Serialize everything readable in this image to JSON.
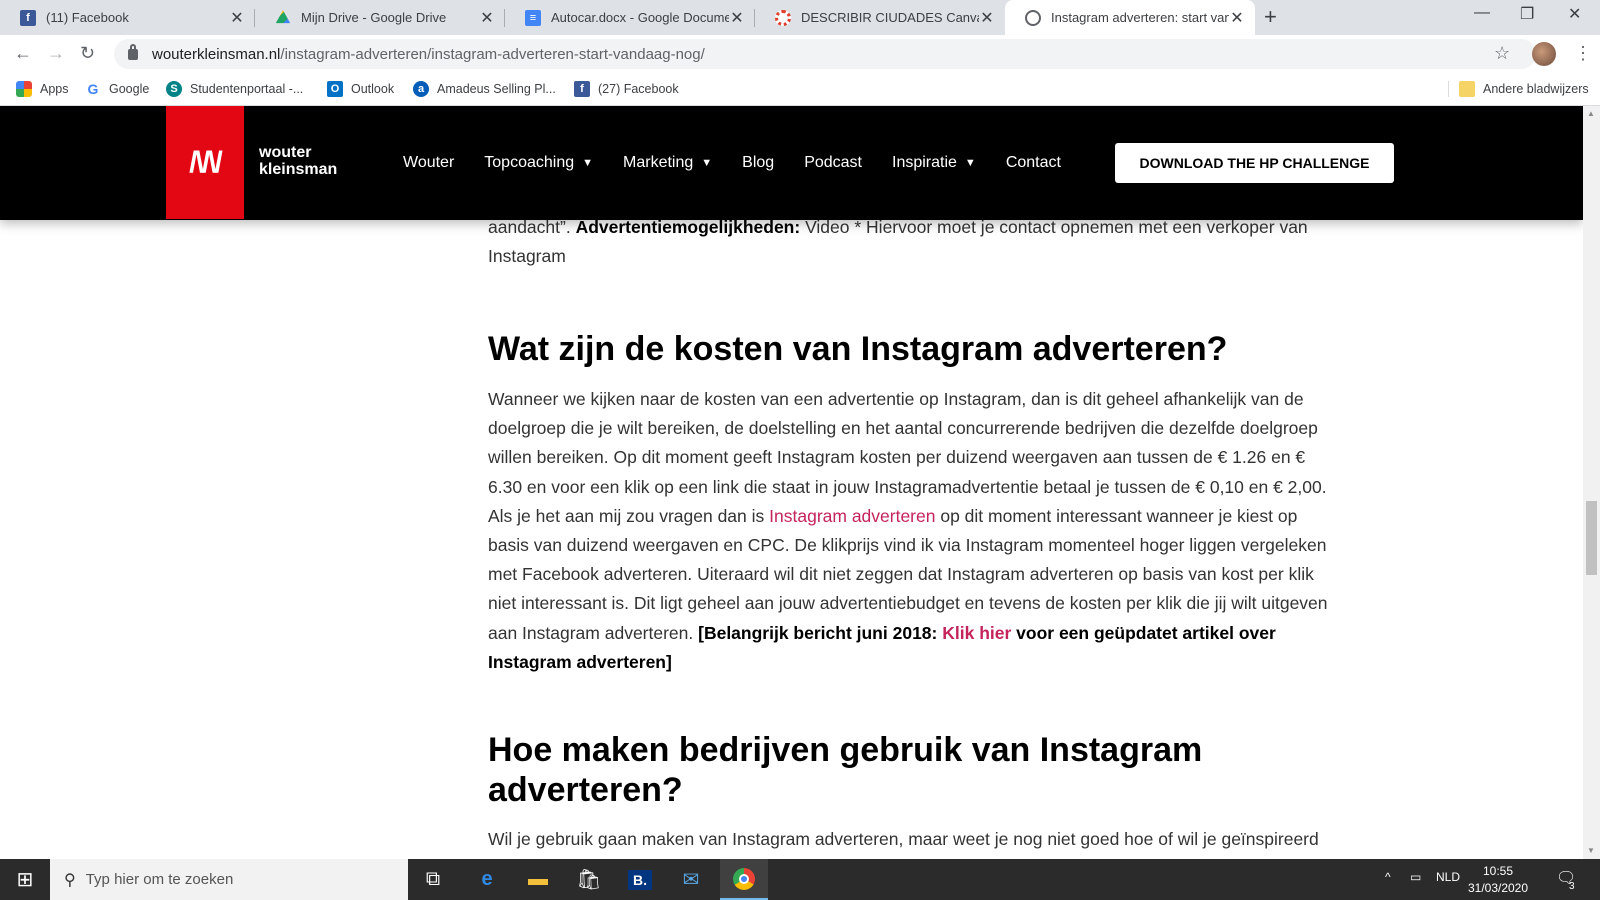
{
  "browser": {
    "tabs": [
      {
        "title": "(11) Facebook",
        "icon": "facebook-icon",
        "color": "#3b5998"
      },
      {
        "title": "Mijn Drive - Google Drive",
        "icon": "google-drive-icon",
        "color": "#1fa463"
      },
      {
        "title": "Autocar.docx - Google Documen",
        "icon": "google-docs-icon",
        "color": "#4285f4"
      },
      {
        "title": "DESCRIBIR CIUDADES Canvas.pdf",
        "icon": "canvas-icon",
        "color": "#e13f2b"
      },
      {
        "title": "Instagram adverteren: start vand",
        "icon": "globe-icon",
        "color": "#5f6368"
      }
    ],
    "new_tab": "+",
    "url_host": "wouterkleinsman.nl",
    "url_path": "/instagram-adverteren/instagram-adverteren-start-vandaag-nog/",
    "bookmarks": [
      {
        "label": "Apps",
        "icon": "apps-icon"
      },
      {
        "label": "Google",
        "icon": "google-icon"
      },
      {
        "label": "Studentenportaal -...",
        "icon": "studentenportaal-icon"
      },
      {
        "label": "Outlook",
        "icon": "outlook-icon"
      },
      {
        "label": "Amadeus Selling Pl...",
        "icon": "amadeus-icon"
      },
      {
        "label": "(27) Facebook",
        "icon": "facebook-icon"
      }
    ],
    "other_bookmarks": "Andere bladwijzers"
  },
  "site": {
    "logo_line1": "wouter",
    "logo_line2": "kleinsman",
    "nav": [
      {
        "label": "Wouter",
        "dropdown": false
      },
      {
        "label": "Topcoaching",
        "dropdown": true
      },
      {
        "label": "Marketing",
        "dropdown": true
      },
      {
        "label": "Blog",
        "dropdown": false
      },
      {
        "label": "Podcast",
        "dropdown": false
      },
      {
        "label": "Inspiratie",
        "dropdown": true
      },
      {
        "label": "Contact",
        "dropdown": false
      }
    ],
    "cta": "DOWNLOAD THE HP CHALLENGE"
  },
  "article": {
    "p0_a": "aandacht”. ",
    "p0_b": "Advertentiemogelijkheden:",
    "p0_c": " Video * Hiervoor moet je contact opnemen met een verkoper van Instagram",
    "h2_1": "Wat zijn de kosten van Instagram adverteren?",
    "p1_a": "Wanneer we kijken naar de kosten van een advertentie op Instagram, dan is dit geheel afhankelijk van de doelgroep die je wilt bereiken, de doelstelling en het aantal concurrerende bedrijven die dezelfde doelgroep willen bereiken. Op dit moment geeft Instagram kosten per duizend weergaven aan tussen de € 1.26 en € 6.30 en voor een klik op een link die staat in jouw Instagramadvertentie betaal je tussen de € 0,10 en € 2,00. Als je het aan mij zou vragen dan is ",
    "p1_link": "Instagram adverteren",
    "p1_b": " op dit moment interessant wanneer je kiest op basis van duizend weergaven en CPC. De klikprijs vind ik via Instagram momenteel hoger liggen vergeleken met Facebook adverteren. Uiteraard wil dit niet zeggen dat Instagram adverteren op basis van kost per klik niet interessant is. Dit ligt geheel aan jouw advertentiebudget en tevens de kosten per klik die jij wilt uitgeven aan Instagram adverteren. ",
    "p1_bold1": "[Belangrijk bericht juni 2018: ",
    "p1_link2": "Klik hier",
    "p1_bold2": " voor een geüpdatet artikel over Instagram adverteren]",
    "h2_2": "Hoe maken bedrijven gebruik van Instagram adverteren?",
    "p2": "Wil je gebruik gaan maken van Instagram adverteren, maar weet je nog niet goed hoe of wil je geïnspireerd"
  },
  "taskbar": {
    "search_placeholder": "Typ hier om te zoeken",
    "lang": "NLD",
    "time": "10:55",
    "date": "31/03/2020",
    "notifications": "3"
  }
}
